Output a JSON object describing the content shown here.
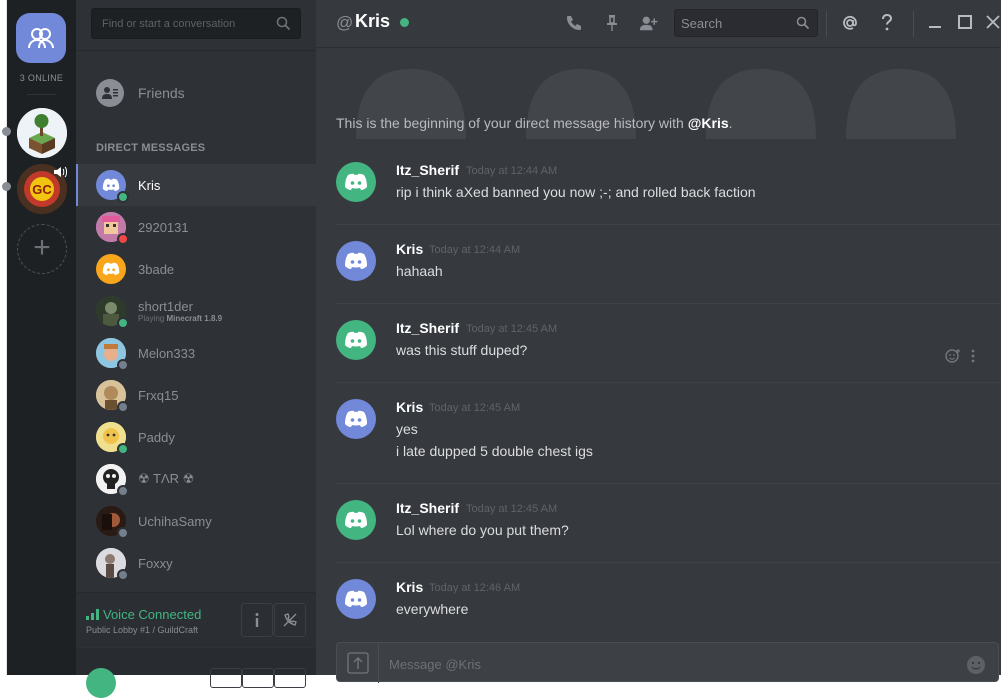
{
  "guilds": {
    "online_count": "3 ONLINE"
  },
  "sidebar": {
    "search_placeholder": "Find or start a conversation",
    "friends_label": "Friends",
    "dm_header": "DIRECT MESSAGES",
    "dms": [
      {
        "name": "Kris",
        "status": "online",
        "avatar": "discord-blue"
      },
      {
        "name": "2920131",
        "status": "dnd",
        "avatar": "pixel-pink"
      },
      {
        "name": "3bade",
        "status": "",
        "avatar": "discord-orange"
      },
      {
        "name": "short1der",
        "status": "online",
        "avatar": "dark-photo",
        "activity_prefix": "Playing",
        "activity_game": "Minecraft 1.8.9"
      },
      {
        "name": "Melon333",
        "status": "offline",
        "avatar": "sky"
      },
      {
        "name": "Frxq15",
        "status": "offline",
        "avatar": "beige"
      },
      {
        "name": "Paddy",
        "status": "online",
        "avatar": "yellow"
      },
      {
        "name": "☢ TΛR ☢",
        "status": "offline",
        "avatar": "skull"
      },
      {
        "name": "UchihaSamy",
        "status": "offline",
        "avatar": "dark-red"
      },
      {
        "name": "Foxxy",
        "status": "offline",
        "avatar": "grey-photo"
      }
    ],
    "voice": {
      "status": "Voice Connected",
      "channel": "Public Lobby #1 / GuildCraft"
    }
  },
  "chat": {
    "title_prefix": "@",
    "title": "Kris",
    "search_placeholder": "Search",
    "intro_text": "This is the beginning of your direct message history with ",
    "intro_user": "@Kris",
    "intro_suffix": ".",
    "messages": [
      {
        "author": "Itz_Sherif",
        "time": "Today at 12:44 AM",
        "avatar": "green",
        "lines": [
          "rip i think aXed banned you now ;-; and rolled back faction"
        ]
      },
      {
        "author": "Kris",
        "time": "Today at 12:44 AM",
        "avatar": "blue",
        "lines": [
          "hahaah"
        ]
      },
      {
        "author": "Itz_Sherif",
        "time": "Today at 12:45 AM",
        "avatar": "green",
        "lines": [
          "was this stuff duped?"
        ]
      },
      {
        "author": "Kris",
        "time": "Today at 12:45 AM",
        "avatar": "blue",
        "lines": [
          "yes",
          "i late dupped 5 double chest igs"
        ]
      },
      {
        "author": "Itz_Sherif",
        "time": "Today at 12:45 AM",
        "avatar": "green",
        "lines": [
          "Lol where do you put them?"
        ]
      },
      {
        "author": "Kris",
        "time": "Today at 12:46 AM",
        "avatar": "blue",
        "lines": [
          "everywhere"
        ]
      }
    ],
    "composer_placeholder": "Message @Kris"
  },
  "colors": {
    "blurple": "#7289da",
    "online_green": "#43b581",
    "dnd_red": "#f04747",
    "background": "#36393e",
    "sidebar": "#2e3136",
    "guild_bar": "#1e2124"
  }
}
